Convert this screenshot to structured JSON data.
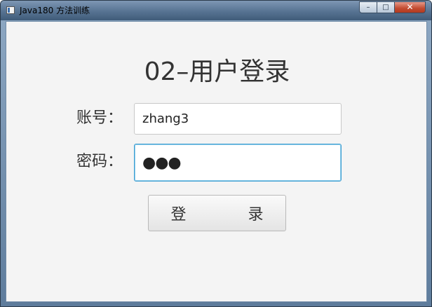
{
  "window": {
    "title": "Java180 方法训练",
    "minimize_glyph": "–",
    "maximize_glyph": "□",
    "close_glyph": "✕"
  },
  "form": {
    "title": "02–用户登录",
    "account_label": "账号：",
    "account_value": "zhang3",
    "password_label": "密码：",
    "password_masked": "●●●",
    "login_button": "登　　　　录"
  }
}
